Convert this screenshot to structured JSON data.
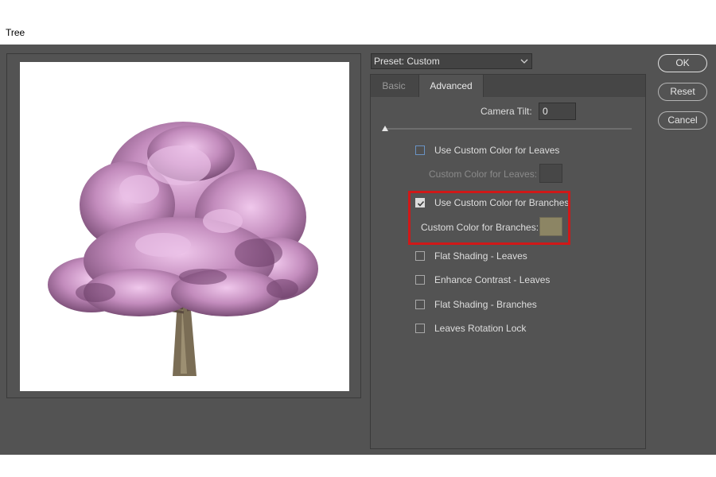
{
  "window": {
    "title": "Tree"
  },
  "preset": {
    "label": "Preset: Custom"
  },
  "tabs": [
    {
      "label": "Basic",
      "active": false
    },
    {
      "label": "Advanced",
      "active": true
    }
  ],
  "camera_tilt": {
    "label": "Camera Tilt:",
    "value": "0",
    "slider_fraction": 0
  },
  "options": {
    "leaves_color_toggle": {
      "label": "Use Custom Color for Leaves",
      "checked": false
    },
    "leaves_color": {
      "label": "Custom Color for Leaves:",
      "enabled": false
    },
    "branches_color_toggle": {
      "label": "Use Custom Color for Branches",
      "checked": true
    },
    "branches_color": {
      "label": "Custom Color for Branches:",
      "value": "#8c8564",
      "enabled": true
    },
    "flat_shading_leaves": {
      "label": "Flat Shading - Leaves",
      "checked": false
    },
    "enhance_contrast_leaves": {
      "label": "Enhance Contrast - Leaves",
      "checked": false
    },
    "flat_shading_branches": {
      "label": "Flat Shading - Branches",
      "checked": false
    },
    "leaves_rotation_lock": {
      "label": "Leaves Rotation Lock",
      "checked": false
    }
  },
  "buttons": {
    "ok": "OK",
    "reset": "Reset",
    "cancel": "Cancel"
  },
  "colors": {
    "dialog_bg": "#535353",
    "highlight_border": "#d01818",
    "tree_foliage": "#b77fb0",
    "tree_trunk": "#7a6d55"
  }
}
